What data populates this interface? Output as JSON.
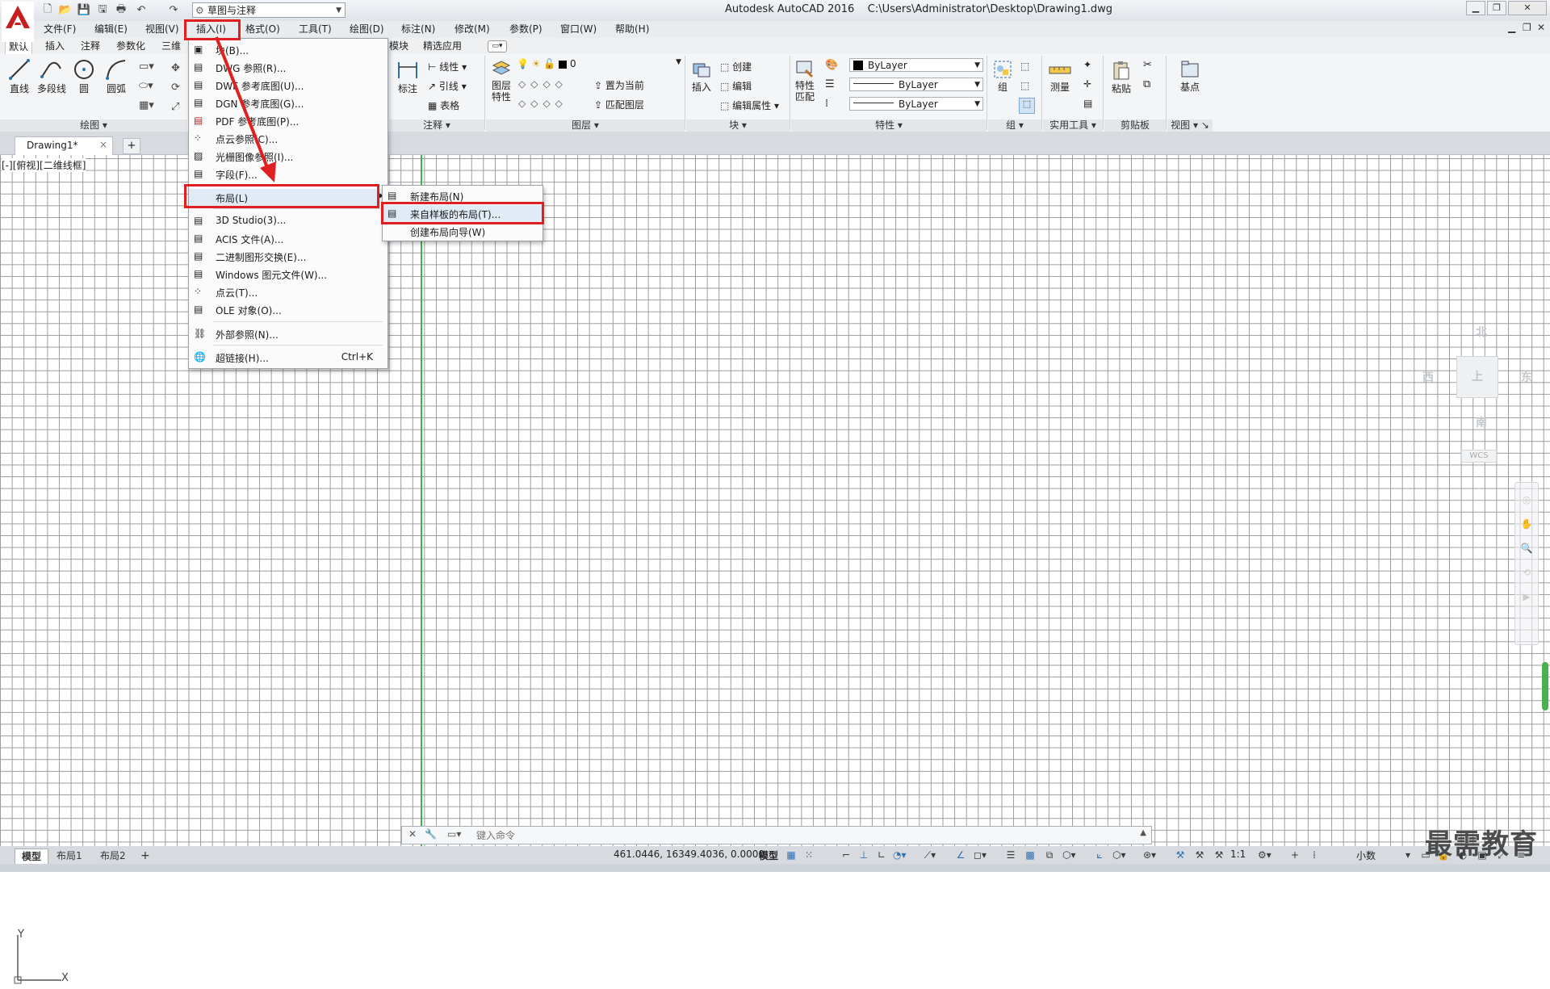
{
  "app": {
    "title": "Autodesk AutoCAD 2016",
    "file_path": "C:\\Users\\Administrator\\Desktop\\Drawing1.dwg",
    "workspace": "草图与注释"
  },
  "menubar": [
    "文件(F)",
    "编辑(E)",
    "视图(V)",
    "插入(I)",
    "格式(O)",
    "工具(T)",
    "绘图(D)",
    "标注(N)",
    "修改(M)",
    "参数(P)",
    "窗口(W)",
    "帮助(H)"
  ],
  "ribbon_tabs": [
    "默认",
    "插入",
    "注释",
    "参数化",
    "三维",
    "模块",
    "精选应用"
  ],
  "ribbon": {
    "draw": {
      "title": "绘图",
      "tools": [
        "直线",
        "多段线",
        "圆",
        "圆弧"
      ]
    },
    "annotation": {
      "title": "注释",
      "big": "标注",
      "items": [
        "线性",
        "引线",
        "表格"
      ]
    },
    "layers": {
      "title": "图层",
      "big": "图层\n特性",
      "layer_name": "0",
      "set_current": "置为当前",
      "match_layer": "匹配图层"
    },
    "block": {
      "title": "块",
      "big": "插入",
      "items": [
        "创建",
        "编辑",
        "编辑属性"
      ]
    },
    "properties": {
      "title": "特性",
      "big": "特性\n匹配",
      "color": "ByLayer",
      "linetype": "ByLayer",
      "lineweight": "ByLayer"
    },
    "groups": {
      "title": "组",
      "big": "组"
    },
    "utilities": {
      "title": "实用工具",
      "big": "测量"
    },
    "clipboard": {
      "title": "剪贴板",
      "big": "粘贴"
    },
    "view": {
      "title": "视图",
      "big": "基点"
    }
  },
  "doc_tab": {
    "name": "Drawing1*",
    "close": "×",
    "add": "+"
  },
  "viewport_label": "[-][俯视][二维线框]",
  "insert_menu": {
    "items": [
      {
        "label": "块(B)...",
        "shortcut": ""
      },
      {
        "label": "DWG 参照(R)...",
        "shortcut": ""
      },
      {
        "label": "DWF 参考底图(U)...",
        "shortcut": ""
      },
      {
        "label": "DGN 参考底图(G)...",
        "shortcut": ""
      },
      {
        "label": "PDF 参考底图(P)...",
        "shortcut": ""
      },
      {
        "label": "点云参照(C)...",
        "shortcut": ""
      },
      {
        "label": "光栅图像参照(I)...",
        "shortcut": ""
      },
      {
        "label": "字段(F)...",
        "shortcut": ""
      },
      {
        "label": "布局(L)",
        "shortcut": ""
      },
      {
        "label": "3D Studio(3)...",
        "shortcut": ""
      },
      {
        "label": "ACIS 文件(A)...",
        "shortcut": ""
      },
      {
        "label": "二进制图形交换(E)...",
        "shortcut": ""
      },
      {
        "label": "Windows 图元文件(W)...",
        "shortcut": ""
      },
      {
        "label": "点云(T)...",
        "shortcut": ""
      },
      {
        "label": "OLE 对象(O)...",
        "shortcut": ""
      },
      {
        "label": "外部参照(N)...",
        "shortcut": ""
      },
      {
        "label": "超链接(H)...",
        "shortcut": "Ctrl+K"
      }
    ]
  },
  "layout_submenu": [
    "新建布局(N)",
    "来自样板的布局(T)...",
    "创建布局向导(W)"
  ],
  "viewcube": {
    "north": "北",
    "south": "南",
    "east": "东",
    "west": "西",
    "face": "上",
    "wcs": "WCS"
  },
  "ucs": {
    "x": "X",
    "y": "Y"
  },
  "command": {
    "placeholder": "键入命令"
  },
  "layout_tabs": [
    "模型",
    "布局1",
    "布局2"
  ],
  "status": {
    "coords": "461.0446, 16349.4036, 0.0000",
    "space": "模型",
    "scale": "1:1",
    "units": "小数"
  },
  "watermark": "最需教育",
  "colors": {
    "highlight": "#e02020",
    "accent_blue": "#2f6fb0",
    "grid": "#9a9a9a"
  }
}
